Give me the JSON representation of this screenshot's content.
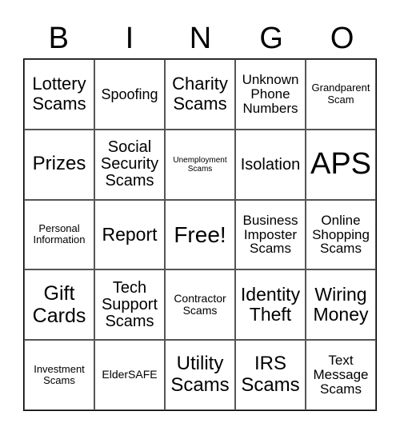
{
  "header": [
    "B",
    "I",
    "N",
    "G",
    "O"
  ],
  "cells": [
    "Lottery Scams",
    "Spoofing",
    "Charity Scams",
    "Unknown Phone Numbers",
    "Grandparent Scam",
    "Prizes",
    "Social Security Scams",
    "Unemployment Scams",
    "Isolation",
    "APS",
    "Personal Information",
    "Report",
    "Free!",
    "Business Imposter Scams",
    "Online Shopping Scams",
    "Gift Cards",
    "Tech Support Scams",
    "Contractor Scams",
    "Identity Theft",
    "Wiring Money",
    "Investment Scams",
    "ElderSAFE",
    "Utility Scams",
    "IRS Scams",
    "Text Message Scams"
  ]
}
